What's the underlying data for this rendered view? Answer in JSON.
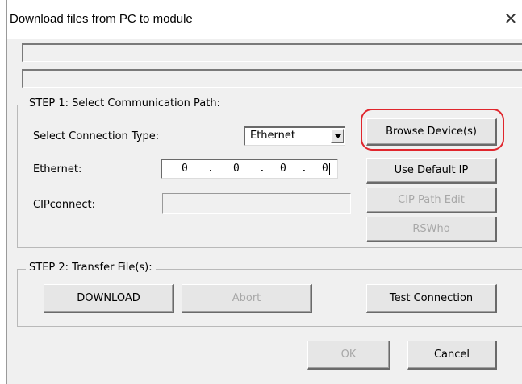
{
  "window": {
    "title": "Download files from PC to module",
    "close_glyph": "✕"
  },
  "step1": {
    "legend": "STEP 1: Select Communication Path:",
    "connection_label": "Select Connection Type:",
    "connection_value": "Ethernet",
    "ethernet_label": "Ethernet:",
    "ip": [
      "0",
      ".",
      "0",
      ".",
      "0",
      ".",
      "0"
    ],
    "cipconnect_label": "CIPconnect:",
    "cipconnect_value": "",
    "browse_button": "Browse Device(s)",
    "default_ip_button": "Use Default IP",
    "cip_path_button": "CIP Path Edit",
    "rswho_button": "RSWho"
  },
  "step2": {
    "legend": "STEP 2: Transfer File(s):",
    "download_button": "DOWNLOAD",
    "abort_button": "Abort",
    "test_button": "Test Connection"
  },
  "footer": {
    "ok_button": "OK",
    "cancel_button": "Cancel"
  },
  "annotation": {
    "highlight_color": "#e0262d",
    "highlight_target": "browse-devices-button"
  }
}
